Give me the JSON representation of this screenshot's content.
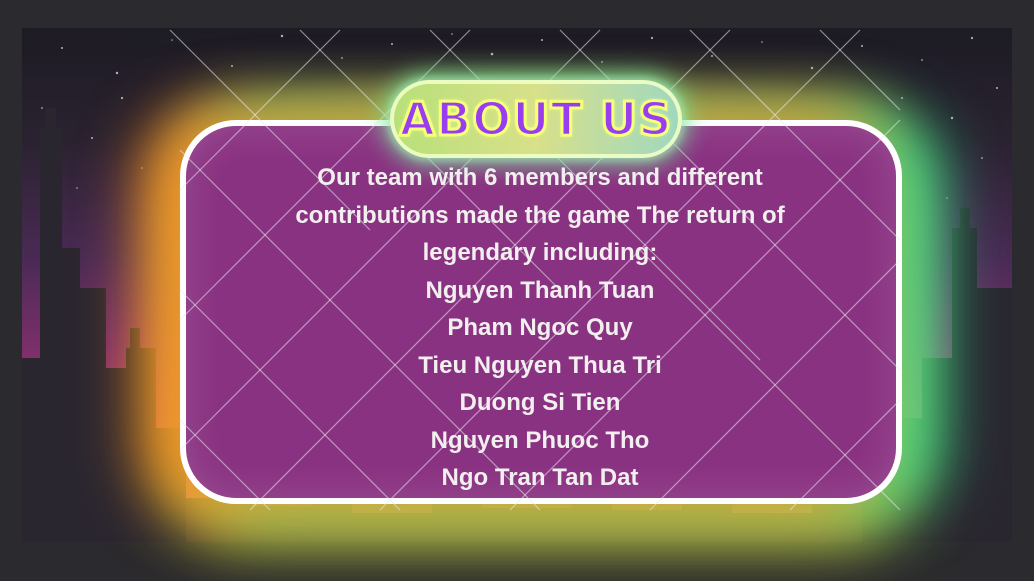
{
  "title": "ABOUT US",
  "intro": "Our team with 6 members and different contributions made the game The return of legendary including:",
  "members": [
    "Nguyen Thanh Tuan",
    "Pham Ngoc Quy",
    "Tieu Nguyen Thua Tri",
    "Duong Si Tien",
    "Nguyen Phuoc Tho",
    "Ngo Tran Tan Dat"
  ],
  "colors": {
    "panel": "#8a3282",
    "title_fill": "#9a3cf0",
    "title_stroke": "#f4ff7a",
    "glow_left": "#ff8c1e",
    "glow_right": "#28e696",
    "glow_bottom": "#e6f03c"
  }
}
